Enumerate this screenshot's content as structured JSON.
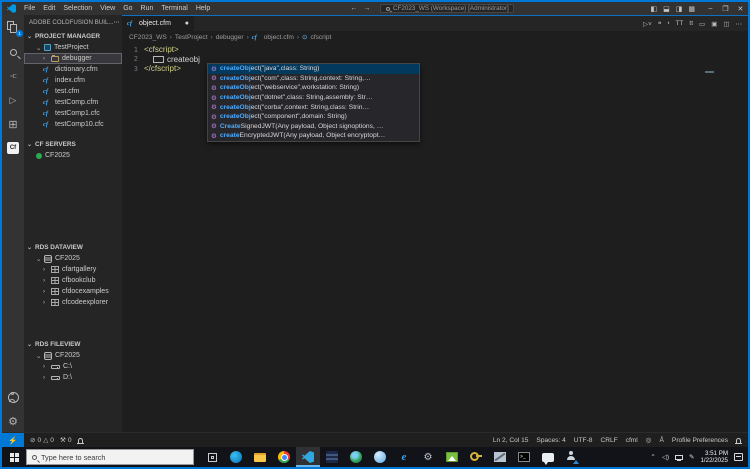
{
  "titlebar": {
    "menus": [
      "File",
      "Edit",
      "Selection",
      "View",
      "Go",
      "Run",
      "Terminal",
      "Help"
    ],
    "back": "←",
    "forward": "→",
    "search": "CF2023_WS (Workspace) [Administrator]",
    "layout_icons": {
      "sidebar_left": "◧",
      "panel": "⬓",
      "sidebar_right": "◨",
      "customize": "▦"
    },
    "window": {
      "minimize": "–",
      "restore": "❐",
      "close": "✕"
    }
  },
  "sidebar": {
    "header": "ADOBE COLDFUSION BUIL...",
    "more": "⋯",
    "project_manager": {
      "title": "PROJECT MANAGER",
      "project": "TestProject",
      "children": [
        "debugger",
        "dictionary.cfm",
        "index.cfm",
        "test.cfm",
        "testComp.cfm",
        "testComp1.cfc",
        "testComp10.cfc"
      ]
    },
    "cf_servers": {
      "title": "CF SERVERS",
      "server": "CF2025"
    },
    "rds_dataview": {
      "title": "RDS DATAVIEW",
      "server": "CF2025",
      "databases": [
        "cfartgallery",
        "cfbookclub",
        "cfdocexamples",
        "cfcodeexplorer"
      ]
    },
    "rds_fileview": {
      "title": "RDS FILEVIEW",
      "server": "CF2025",
      "drives": [
        "C:\\",
        "D:\\"
      ]
    }
  },
  "tab": {
    "name": "object.cfm",
    "modified_dot": "●"
  },
  "editor_toolbar": {
    "icons": [
      "▷˅",
      "❝",
      "❛",
      "TT",
      "tt",
      "▭",
      "▣",
      "◫",
      "⋯"
    ]
  },
  "breadcrumb": {
    "items": [
      "CF2023_WS",
      "TestProject",
      "debugger",
      "object.cfm",
      "cfscript"
    ],
    "separator": "›"
  },
  "editor": {
    "line_numbers": [
      "1",
      "2",
      "3"
    ],
    "line1": "<cfscript>",
    "line2": "createobj",
    "line3": "</cfscript>"
  },
  "suggest": {
    "icon": "⚙",
    "items": [
      {
        "match": "createObj",
        "rest": "ect(\"java\",class: String)"
      },
      {
        "match": "createObj",
        "rest": "ect(\"com\",class: String,context: String,…"
      },
      {
        "match": "createObj",
        "rest": "ect(\"webservice\",workstation: String)"
      },
      {
        "match": "createObj",
        "rest": "ect(\"dotnet\",class: String,assembly: Str…"
      },
      {
        "match": "createObj",
        "rest": "ect(\"corba\",context: String,class: Strin…"
      },
      {
        "match": "createObj",
        "rest": "ect(\"component\",domain: String)"
      },
      {
        "match": "Create",
        "rest": "SignedJWT(Any payload, Object signoptions, …"
      },
      {
        "match": "create",
        "rest": "EncryptedJWT(Any payload, Object encryptopt…"
      }
    ]
  },
  "status": {
    "remote": "⚡",
    "error_icon": "⊘",
    "errors": "0",
    "warning_icon": "△",
    "warnings": "0",
    "tasks_icon": "⚒",
    "tasks": "0",
    "line_col": "Ln 2, Col 15",
    "spaces": "Spaces: 4",
    "encoding": "UTF-8",
    "eol": "CRLF",
    "language": "cfml",
    "lang_status": "◎",
    "accessibility": "Å",
    "profile": "Profile Preferences"
  },
  "taskbar": {
    "search_placeholder": "Type here to search",
    "tray_expand": "⌃",
    "volume": "◁)",
    "pen": "✎",
    "time": "3:51 PM",
    "date": "1/22/2025"
  },
  "colors": {
    "accent_blue": "#0078d4",
    "window_border": "#0078d7",
    "server_online": "#2bab52",
    "selection_bg": "#04395e"
  }
}
